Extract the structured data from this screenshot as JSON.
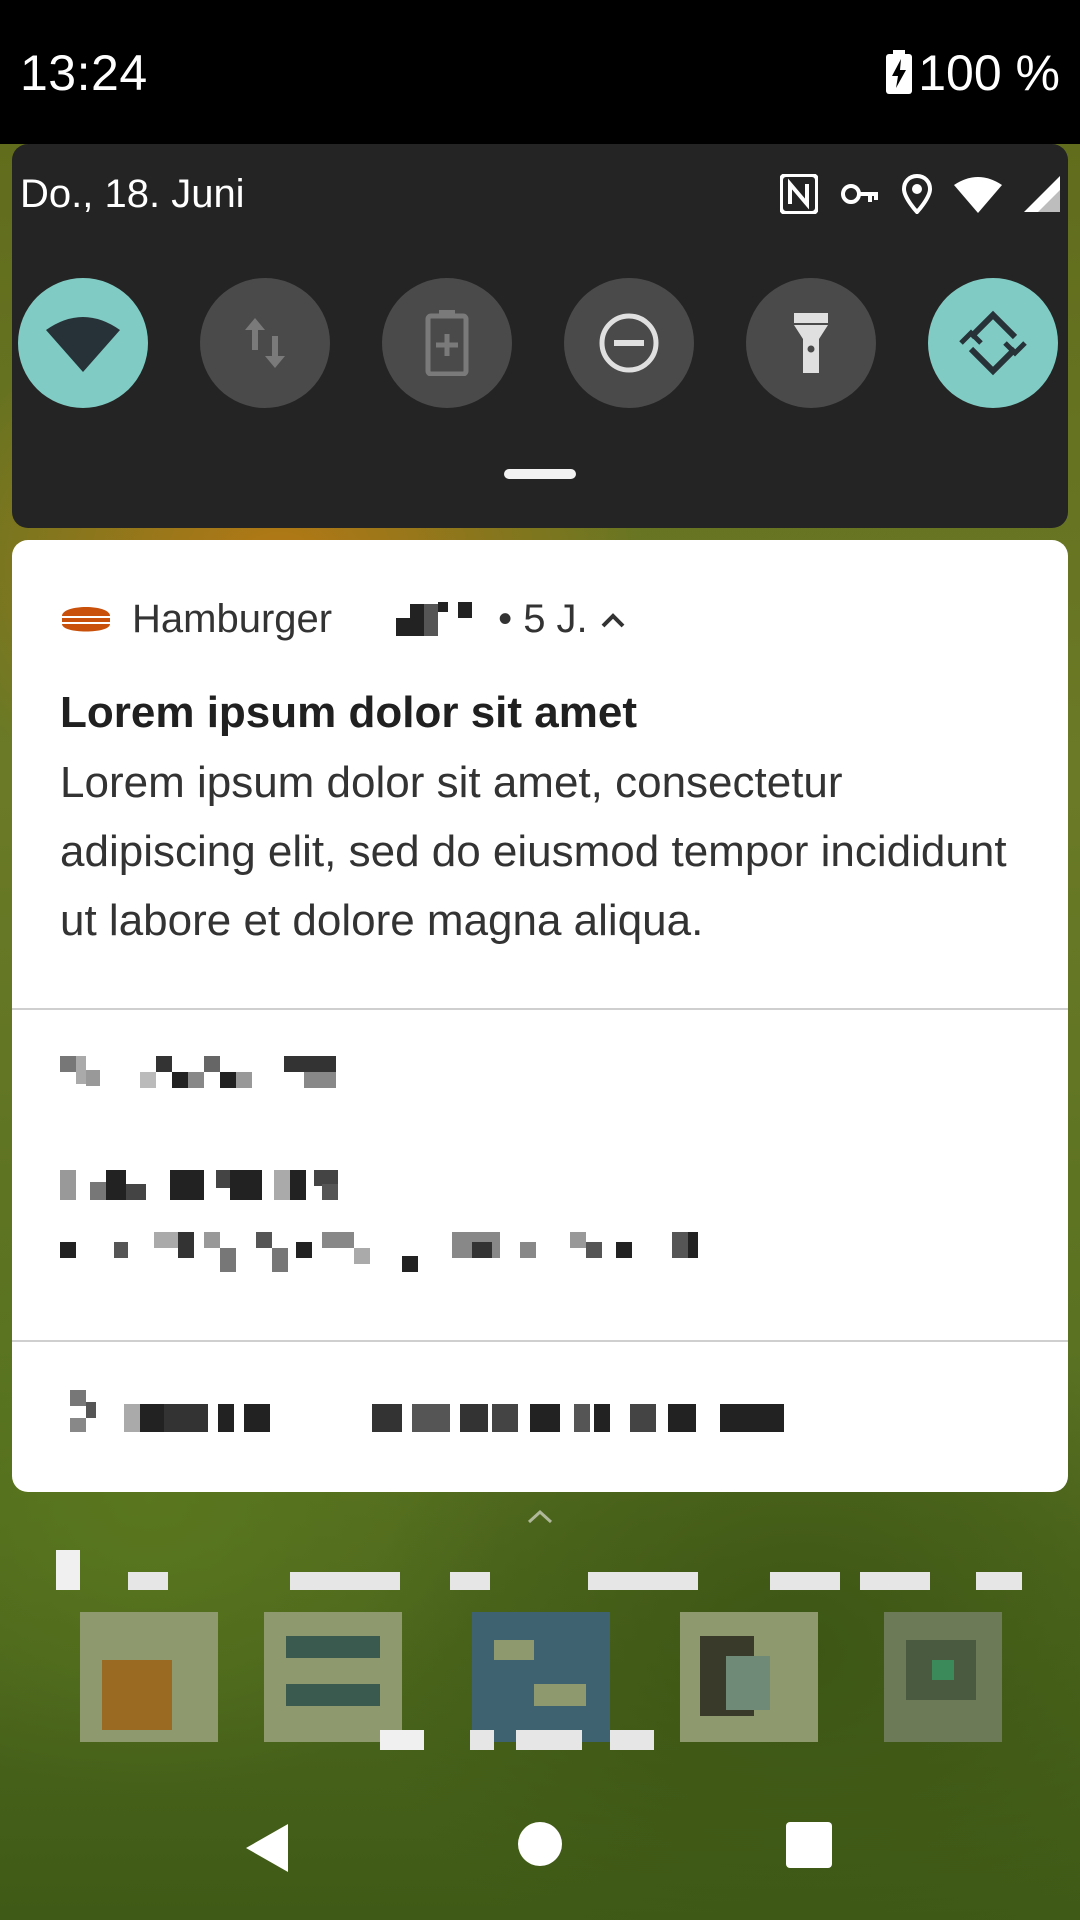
{
  "status_bar": {
    "time": "13:24",
    "battery": "100 %",
    "battery_icon": "battery-charging-icon"
  },
  "quick_settings": {
    "date": "Do., 18. Juni",
    "status_icons": [
      "nfc-icon",
      "vpn-key-icon",
      "location-icon",
      "wifi-icon",
      "cell-signal-icon"
    ],
    "tiles": [
      {
        "name": "wifi",
        "icon": "wifi-icon",
        "active": true
      },
      {
        "name": "mobile-data",
        "icon": "data-arrows-icon",
        "active": false
      },
      {
        "name": "battery-saver",
        "icon": "battery-saver-icon",
        "active": false
      },
      {
        "name": "do-not-disturb",
        "icon": "dnd-icon",
        "active": false
      },
      {
        "name": "flashlight",
        "icon": "flashlight-icon",
        "active": false
      },
      {
        "name": "auto-rotate",
        "icon": "auto-rotate-icon",
        "active": true
      }
    ],
    "accent": "#80cbc4"
  },
  "notification": {
    "app_name": "Hamburger",
    "meta": "• 5 J.",
    "title": "Lorem ipsum dolor sit amet",
    "body": "Lorem ipsum dolor sit amet, consectetur adipiscing elit, sed do eiusmod tempor incididunt ut labore et dolore magna aliqua.",
    "app_icon_color": "#c8500a"
  },
  "navigation": {
    "back": "back-icon",
    "home": "home-icon",
    "recents": "recents-icon"
  }
}
